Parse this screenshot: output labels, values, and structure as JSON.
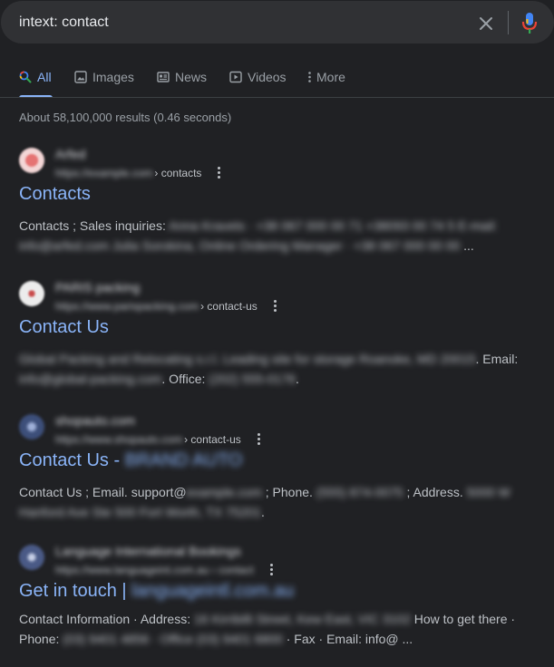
{
  "search": {
    "query": "intext: contact"
  },
  "tabs": [
    {
      "label": "All",
      "active": true,
      "icon": "search-icon"
    },
    {
      "label": "Images",
      "active": false,
      "icon": "image-icon"
    },
    {
      "label": "News",
      "active": false,
      "icon": "news-icon"
    },
    {
      "label": "Videos",
      "active": false,
      "icon": "play-icon"
    },
    {
      "label": "More",
      "active": false,
      "icon": "more-vert-icon"
    }
  ],
  "stats": "About 58,100,000 results (0.46 seconds)",
  "colors": {
    "background": "#202124",
    "search_bar": "#303134",
    "link": "#8ab4f8",
    "text": "#bdc1c6"
  },
  "results": [
    {
      "site_name": "Arfed",
      "cite_domain": "https://example.com",
      "cite_path": "› contacts",
      "title": "Contacts",
      "title_blurred": "",
      "snippet_line1": [
        "Contacts ; Sales inquiries: ",
        "Anna Kravets · +38 067 000 00 71 +38093 00 74 5 E-mail:",
        ""
      ],
      "snippet_line2": [
        "",
        "info@arfed.com Julia Sorokina, Online Ordering Manager · +38 067 000 00 00 ",
        "..."
      ]
    },
    {
      "site_name": "PARIS packing",
      "cite_domain": "https://www.parispacking.com",
      "cite_path": "› contact-us",
      "title": "Contact Us",
      "title_blurred": "",
      "snippet_line1": [
        "",
        "Global Packing and Relocating s.r.l. Leading site for storage Roanoke, MD 20015",
        ". Email:"
      ],
      "snippet_line2": [
        "",
        "info@global-packing.com",
        ". Office: "
      ],
      "snippet_line2_tail": [
        "(202) 555-0176",
        "."
      ]
    },
    {
      "site_name": "shopauto.com",
      "cite_domain": "https://www.shopauto.com",
      "cite_path": "› contact-us",
      "title": "Contact Us - ",
      "title_blurred": "BRAND AUTO",
      "snippet_line1": [
        "Contact Us ; Email. support@",
        "example.com",
        " ; Phone. "
      ],
      "snippet_line1_tail": [
        "(555) 874-0075",
        " ; Address. ",
        "5000 W"
      ],
      "snippet_line2": [
        "",
        "Hanford Ave Ste 500 Fort Worth, TX 75201",
        "."
      ]
    },
    {
      "site_name": "Language International Bookings",
      "cite_domain": "https://www.languageint.com.au › contact",
      "cite_path": "",
      "title": "Get in touch | ",
      "title_blurred": "languageintl.com.au",
      "snippet_line1": [
        "Contact Information · Address: ",
        "16 Kirribilli Street, Kew East, VIC 3102",
        " How to get there ·"
      ],
      "snippet_line2": [
        "Phone: ",
        "(03) 9401 4856 · Office (03) 9401 6800",
        " · Fax · Email: info@ ..."
      ]
    }
  ]
}
